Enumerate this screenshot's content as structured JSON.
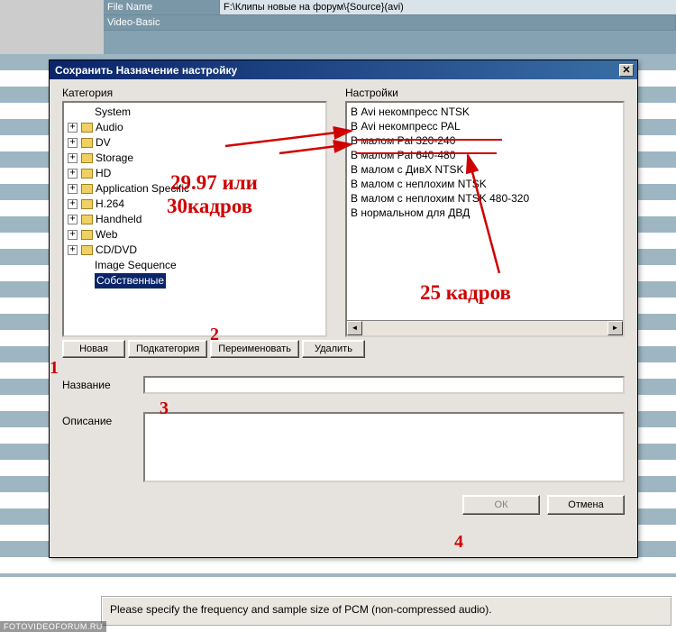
{
  "background": {
    "fileNameLabel": "File Name",
    "fileNameValue": "F:\\Клипы новые на форум\\{Source}(avi)",
    "videoBasicLabel": "Video-Basic"
  },
  "dialog": {
    "title": "Сохранить Назначение настройку",
    "categoryLabel": "Категория",
    "settingsLabel": "Настройки",
    "tree": {
      "items": [
        {
          "type": "leaf",
          "label": "System"
        },
        {
          "type": "branch",
          "label": "Audio"
        },
        {
          "type": "branch",
          "label": "DV"
        },
        {
          "type": "branch",
          "label": "Storage"
        },
        {
          "type": "branch",
          "label": "HD"
        },
        {
          "type": "branch",
          "label": "Application Specific"
        },
        {
          "type": "branch",
          "label": "H.264"
        },
        {
          "type": "branch",
          "label": "Handheld"
        },
        {
          "type": "branch",
          "label": "Web"
        },
        {
          "type": "branch",
          "label": "CD/DVD"
        },
        {
          "type": "leaf",
          "label": "Image Sequence"
        },
        {
          "type": "leaf",
          "label": "Собственные",
          "selected": true
        }
      ]
    },
    "settings": [
      "В Avi некомпресс NTSK",
      "В Avi некомпресс PAL",
      "В малом Pal 320-240",
      "В малом Pal 640-480",
      "В малом с ДивХ NTSK",
      "В малом с неплохим NTSK",
      "В малом с неплохим NTSK 480-320",
      "В нормальном для ДВД"
    ],
    "buttons": {
      "new": "Новая",
      "subcategory": "Подкатегория",
      "rename": "Переименовать",
      "delete": "Удалить",
      "ok": "ОК",
      "cancel": "Отмена"
    },
    "nameLabel": "Название",
    "nameValue": "",
    "descLabel": "Описание",
    "descValue": ""
  },
  "statusBar": "Please specify the frequency and sample size of PCM (non-compressed audio).",
  "watermark": "FOTOVIDEOFORUM.RU",
  "annotations": {
    "n1": "1",
    "n2": "2",
    "n3": "3",
    "n4": "4",
    "text1a": "29.97 или",
    "text1b": "30кадров",
    "text2": "25 кадров"
  }
}
